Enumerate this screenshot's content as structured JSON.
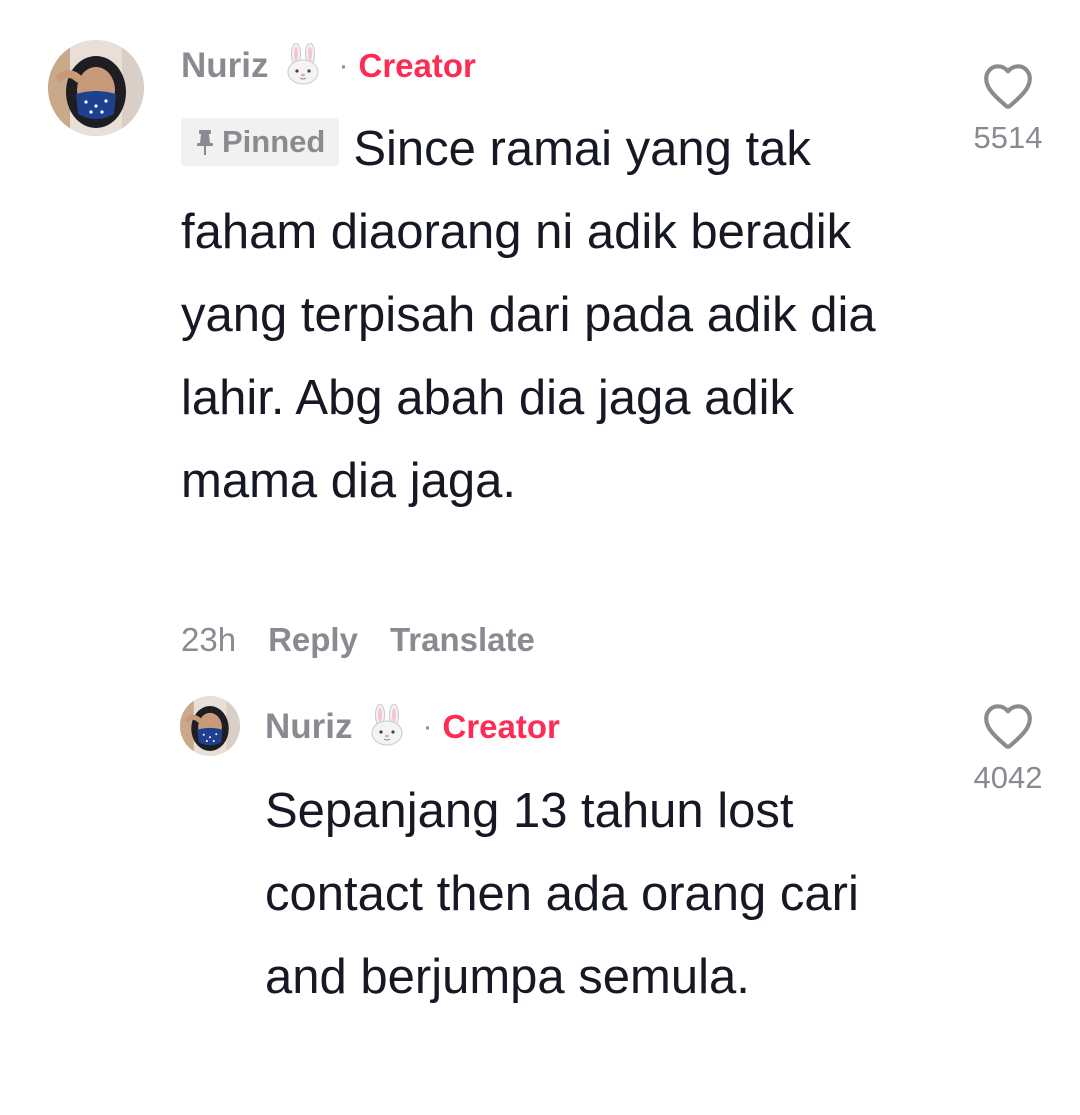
{
  "comments": [
    {
      "author": "Nuriz",
      "author_emoji": "rabbit-face-icon",
      "separator": "·",
      "role_badge": "Creator",
      "pinned_label": "Pinned",
      "text": "Since ramai yang tak faham diaorang ni adik beradik yang terpisah dari pada adik dia lahir. Abg abah dia jaga adik mama dia jaga.",
      "time": "23h",
      "reply_label": "Reply",
      "translate_label": "Translate",
      "like_count": "5514"
    },
    {
      "author": "Nuriz",
      "author_emoji": "rabbit-face-icon",
      "separator": "·",
      "role_badge": "Creator",
      "text": "Sepanjang 13 tahun lost contact then ada orang cari and berjumpa semula.",
      "like_count": "4042"
    }
  ],
  "colors": {
    "creator": "#fe2c55",
    "muted": "#8a8b91",
    "text": "#161823",
    "pinned_bg": "#f1f1f2"
  }
}
